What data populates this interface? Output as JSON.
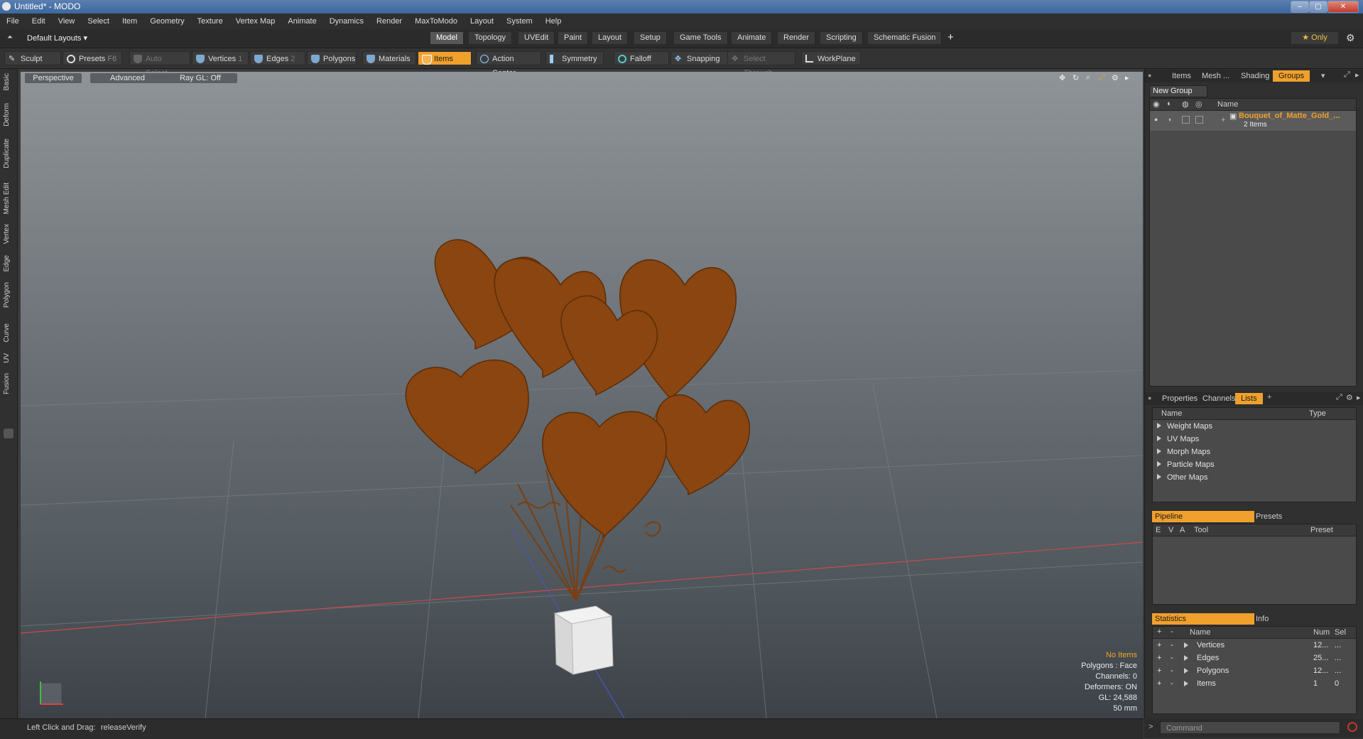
{
  "window": {
    "title": "Untitled* - MODO",
    "min_label": "–",
    "max_label": "▢",
    "close_label": "✕"
  },
  "menubar": [
    "File",
    "Edit",
    "View",
    "Select",
    "Item",
    "Geometry",
    "Texture",
    "Vertex Map",
    "Animate",
    "Dynamics",
    "Render",
    "MaxToModo",
    "Layout",
    "System",
    "Help"
  ],
  "layout_selector": "Default Layouts ▾",
  "layout_tabs": [
    "Model",
    "Topology",
    "UVEdit",
    "Paint",
    "Layout",
    "Setup",
    "Game Tools",
    "Animate",
    "Render",
    "Scripting",
    "Schematic Fusion"
  ],
  "add_tab_label": "+",
  "only_label": "★ Only",
  "toolbar": {
    "sculpt": "Sculpt",
    "presets": "Presets",
    "presets_key": "F6",
    "auto_select": "Auto Select",
    "vertices": "Vertices",
    "vertices_key": "1",
    "edges": "Edges",
    "edges_key": "2",
    "polygons": "Polygons",
    "materials": "Materials",
    "items": "Items",
    "action_center": "Action Center",
    "symmetry": "Symmetry",
    "falloff": "Falloff",
    "snapping": "Snapping",
    "select_through": "Select Through",
    "workplane": "WorkPlane"
  },
  "left_tabs": [
    "Basic",
    "Deform",
    "Duplicate",
    "Mesh Edit",
    "Vertex",
    "Edge",
    "Polygon",
    "Curve",
    "UV",
    "Fusion"
  ],
  "viewport": {
    "perspective": "Perspective",
    "advanced": "Advanced",
    "raygl": "Ray GL: Off",
    "stats": {
      "no_items": "No Items",
      "polygons": "Polygons : Face",
      "channels": "Channels: 0",
      "deformers": "Deformers: ON",
      "gl": "GL: 24,588",
      "lens": "50 mm"
    }
  },
  "status": {
    "hint": "Left Click and Drag:",
    "action": "releaseVerify"
  },
  "groups_panel": {
    "tabs": [
      "Items",
      "Mesh ...",
      "Shading",
      "Groups"
    ],
    "new_group": "New Group",
    "name_header": "Name",
    "item_name": "Bouquet_of_Matte_Gold_...",
    "item_count": "2 Items"
  },
  "lists_panel": {
    "tabs": [
      "Properties",
      "Channels",
      "Lists"
    ],
    "add": "+",
    "headers": {
      "name": "Name",
      "type": "Type"
    },
    "rows": [
      "Weight Maps",
      "UV Maps",
      "Morph Maps",
      "Particle Maps",
      "Other Maps"
    ]
  },
  "pipeline_panel": {
    "tabs": [
      "Pipeline",
      "Presets"
    ],
    "headers": {
      "e": "E",
      "v": "V",
      "a": "A",
      "tool": "Tool",
      "preset": "Preset"
    }
  },
  "statistics_panel": {
    "tabs": [
      "Statistics",
      "Info"
    ],
    "headers": {
      "plus": "+",
      "minus": "-",
      "name": "Name",
      "num": "Num",
      "sel": "Sel"
    },
    "rows": [
      {
        "name": "Vertices",
        "num": "12...",
        "sel": "..."
      },
      {
        "name": "Edges",
        "num": "25...",
        "sel": "..."
      },
      {
        "name": "Polygons",
        "num": "12...",
        "sel": "..."
      },
      {
        "name": "Items",
        "num": "1",
        "sel": "0"
      }
    ]
  },
  "command": {
    "placeholder": "Command",
    "prompt": ">"
  },
  "colors": {
    "accent": "#f0a02c",
    "balloon": "#8a4510",
    "box": "#e6e6e6"
  }
}
